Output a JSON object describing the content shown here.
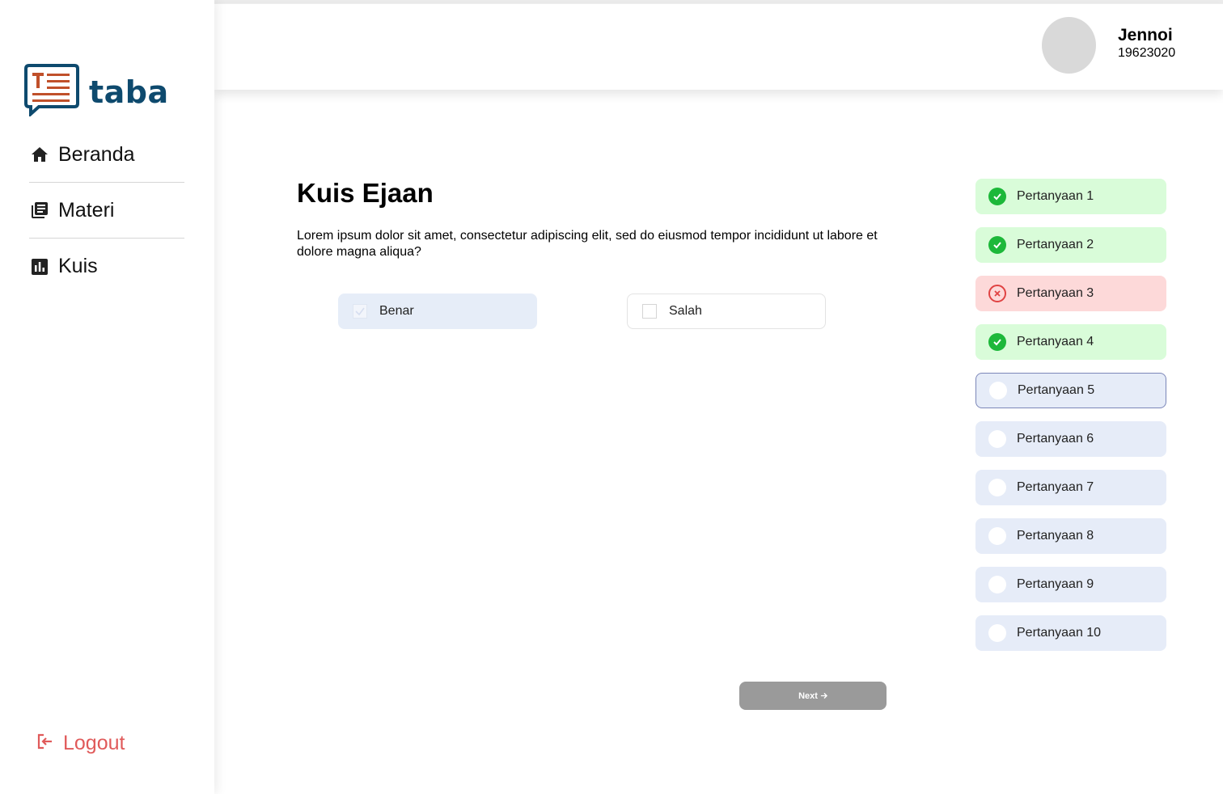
{
  "brand": {
    "name": "taba"
  },
  "sidebar": {
    "items": [
      {
        "label": "Beranda",
        "icon": "home-icon"
      },
      {
        "label": "Materi",
        "icon": "library-books-icon"
      },
      {
        "label": "Kuis",
        "icon": "bar-chart-icon"
      }
    ],
    "logout_label": "Logout"
  },
  "user": {
    "name": "Jennoi",
    "id": "19623020"
  },
  "quiz": {
    "title": "Kuis Ejaan",
    "question": "Lorem ipsum dolor sit amet, consectetur adipiscing elit, sed do eiusmod tempor incididunt ut labore et dolore magna aliqua?",
    "options": [
      {
        "label": "Benar",
        "selected": true
      },
      {
        "label": "Salah",
        "selected": false
      }
    ],
    "next_label": "Next"
  },
  "questions": [
    {
      "label": "Pertanyaan 1",
      "status": "correct"
    },
    {
      "label": "Pertanyaan 2",
      "status": "correct"
    },
    {
      "label": "Pertanyaan 3",
      "status": "wrong"
    },
    {
      "label": "Pertanyaan 4",
      "status": "correct"
    },
    {
      "label": "Pertanyaan 5",
      "status": "current"
    },
    {
      "label": "Pertanyaan 6",
      "status": "pending"
    },
    {
      "label": "Pertanyaan 7",
      "status": "pending"
    },
    {
      "label": "Pertanyaan 8",
      "status": "pending"
    },
    {
      "label": "Pertanyaan 9",
      "status": "pending"
    },
    {
      "label": "Pertanyaan 10",
      "status": "pending"
    }
  ],
  "colors": {
    "brand": "#0e4a6e",
    "brand_accent": "#c0502a",
    "correct": "#1db83a",
    "wrong": "#e04343",
    "logout": "#e05a5a"
  }
}
